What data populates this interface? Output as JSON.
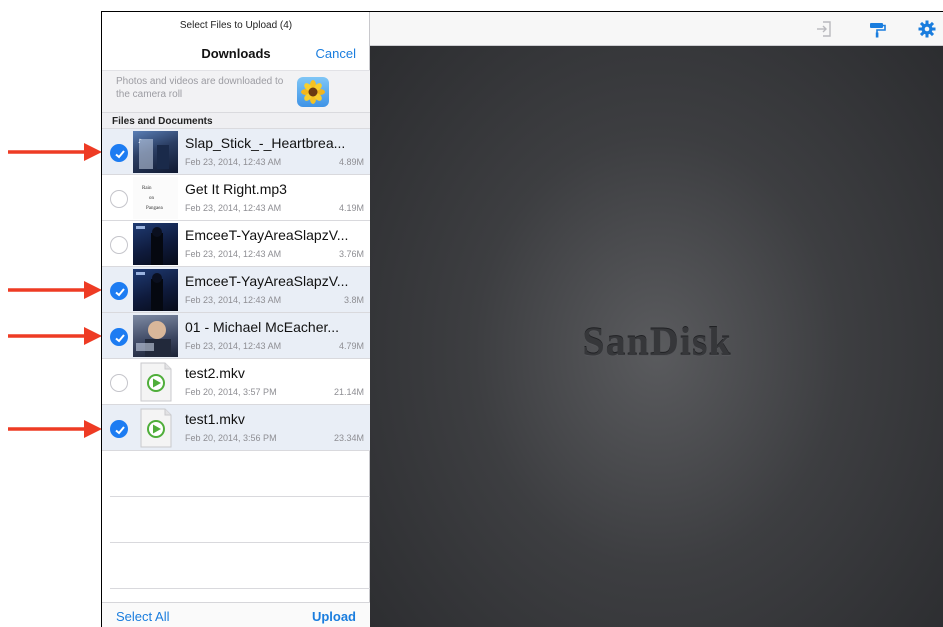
{
  "panel": {
    "title": "Select Files to Upload (4)",
    "nav_title": "Downloads",
    "cancel_label": "Cancel",
    "photos_note": "Photos and videos are downloaded to the camera roll",
    "photos_icon": "photos-sunflower-icon",
    "section_header": "Files and Documents",
    "files": [
      {
        "name": "Slap_Stick_-_Heartbrea...",
        "date": "Feb 23, 2014, 12:43 AM",
        "size": "4.89M",
        "selected": true,
        "thumb": "album-art"
      },
      {
        "name": "Get It Right.mp3",
        "date": "Feb 23, 2014, 12:43 AM",
        "size": "4.19M",
        "selected": false,
        "thumb": "album-art-text",
        "thumb_text": "Rain on Pangaea"
      },
      {
        "name": "EmceeT-YayAreaSlapzV...",
        "date": "Feb 23, 2014, 12:43 AM",
        "size": "3.76M",
        "selected": false,
        "thumb": "album-art"
      },
      {
        "name": "EmceeT-YayAreaSlapzV...",
        "date": "Feb 23, 2014, 12:43 AM",
        "size": "3.8M",
        "selected": true,
        "thumb": "album-art"
      },
      {
        "name": "01 - Michael McEacher...",
        "date": "Feb 23, 2014, 12:43 AM",
        "size": "4.79M",
        "selected": true,
        "thumb": "album-art"
      },
      {
        "name": "test2.mkv",
        "date": "Feb 20, 2014, 3:57 PM",
        "size": "21.14M",
        "selected": false,
        "thumb": "video-file-icon"
      },
      {
        "name": "test1.mkv",
        "date": "Feb 20, 2014, 3:56 PM",
        "size": "23.34M",
        "selected": true,
        "thumb": "video-file-icon"
      }
    ],
    "select_all_label": "Select All",
    "upload_label": "Upload"
  },
  "toolbar": {
    "icons": [
      "sign-in-icon",
      "paint-roller-icon",
      "gear-icon"
    ],
    "accent": "#1a7dde"
  },
  "canvas": {
    "brand": "SanDisk"
  },
  "annotations": {
    "arrow_color": "#ee3b24",
    "arrow_count": 4
  },
  "colors": {
    "selected_check": "#1d7cf2",
    "selected_row": "#e9eef6"
  }
}
